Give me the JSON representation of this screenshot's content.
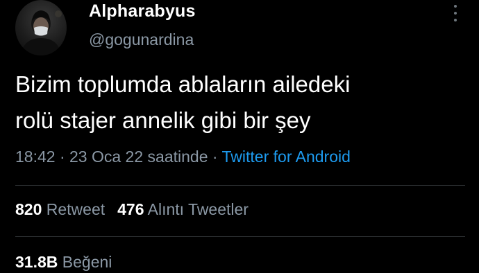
{
  "user": {
    "display_name": "Alpharabyus",
    "handle": "@gogunardina"
  },
  "menu": {
    "icon": "more-vertical-icon"
  },
  "tweet": {
    "lines": [
      "Bizim toplumda ablaların ailedeki",
      "rolü stajer annelik gibi bir şey"
    ]
  },
  "meta": {
    "time": "18:42",
    "separator1": " · ",
    "date": "23 Oca 22 saatinde",
    "separator2": " · ",
    "source": "Twitter for Android"
  },
  "stats": {
    "retweets_count": "820",
    "retweets_label": "Retweet",
    "quotes_count": "476",
    "quotes_label": "Alıntı Tweetler",
    "likes_count": "31.8B",
    "likes_label": "Beğeni"
  },
  "colors": {
    "background": "#000000",
    "primary_text": "#ffffff",
    "secondary_text": "#8b98a5",
    "link": "#1d9bf0",
    "divider": "#2f3336"
  }
}
